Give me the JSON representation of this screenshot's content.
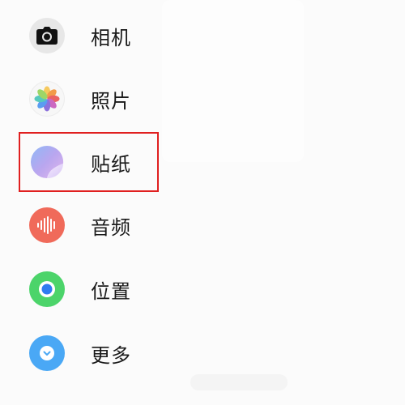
{
  "menu": {
    "items": [
      {
        "label": "相机",
        "icon": "camera-icon"
      },
      {
        "label": "照片",
        "icon": "photos-icon"
      },
      {
        "label": "贴纸",
        "icon": "sticker-icon"
      },
      {
        "label": "音频",
        "icon": "audio-icon"
      },
      {
        "label": "位置",
        "icon": "location-icon"
      },
      {
        "label": "更多",
        "icon": "more-icon"
      }
    ]
  },
  "colors": {
    "highlight": "#e02020",
    "audio": "#f06a5a",
    "location": "#4cd46a",
    "more": "#4aa8f5",
    "camera_bg": "#e7e7e7"
  }
}
